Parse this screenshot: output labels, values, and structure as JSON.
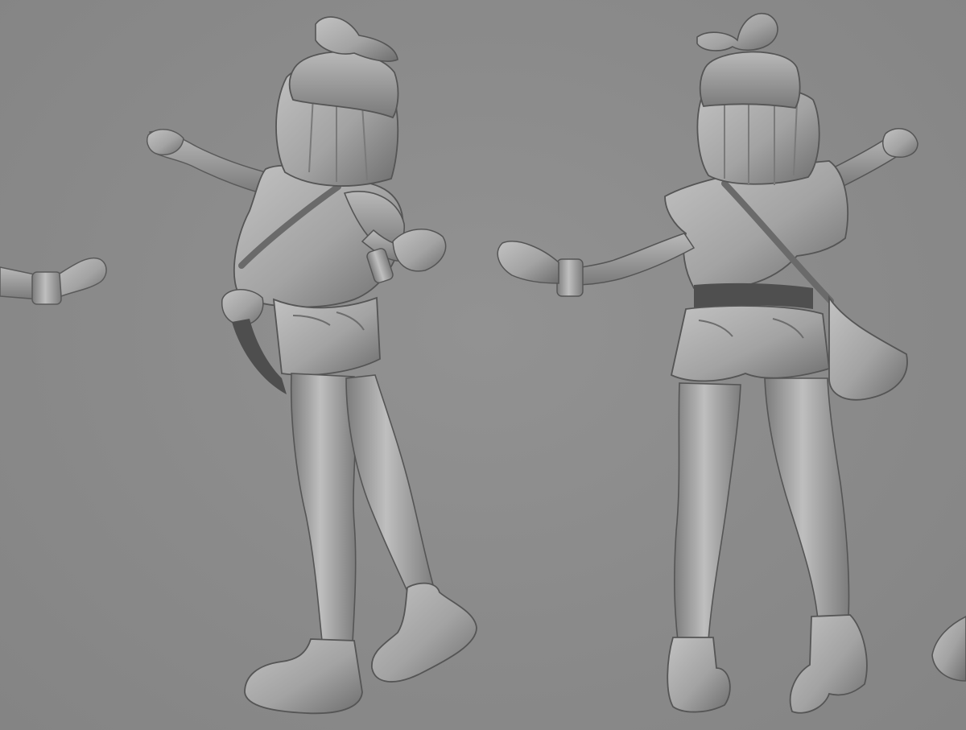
{
  "scene": {
    "kind": "3d-sculpt-render",
    "material": "grey-clay",
    "background_color": "#8a8a8a",
    "clay_light": "#bdbdbd",
    "clay_mid": "#9e9e9e",
    "clay_shadow": "#5e5e5e",
    "figures": [
      {
        "name": "partial-figure-left-edge",
        "view": "cropped",
        "visible_parts": [
          "hand",
          "wristband"
        ]
      },
      {
        "name": "character-three-quarter-back-view",
        "view": "three-quarter-back",
        "visible_parts": [
          "hat-with-bow",
          "bob-hair",
          "short-sleeve-top",
          "shoulder-strap",
          "denim-shorts",
          "legs",
          "sneakers",
          "wristband"
        ]
      },
      {
        "name": "character-back-view",
        "view": "back",
        "visible_parts": [
          "hat-with-bow",
          "bob-hair",
          "short-sleeve-top",
          "shoulder-bag",
          "denim-shorts",
          "legs",
          "boots",
          "wristband"
        ]
      },
      {
        "name": "partial-figure-right-edge",
        "view": "cropped",
        "visible_parts": [
          "shoe-tip"
        ]
      }
    ]
  }
}
